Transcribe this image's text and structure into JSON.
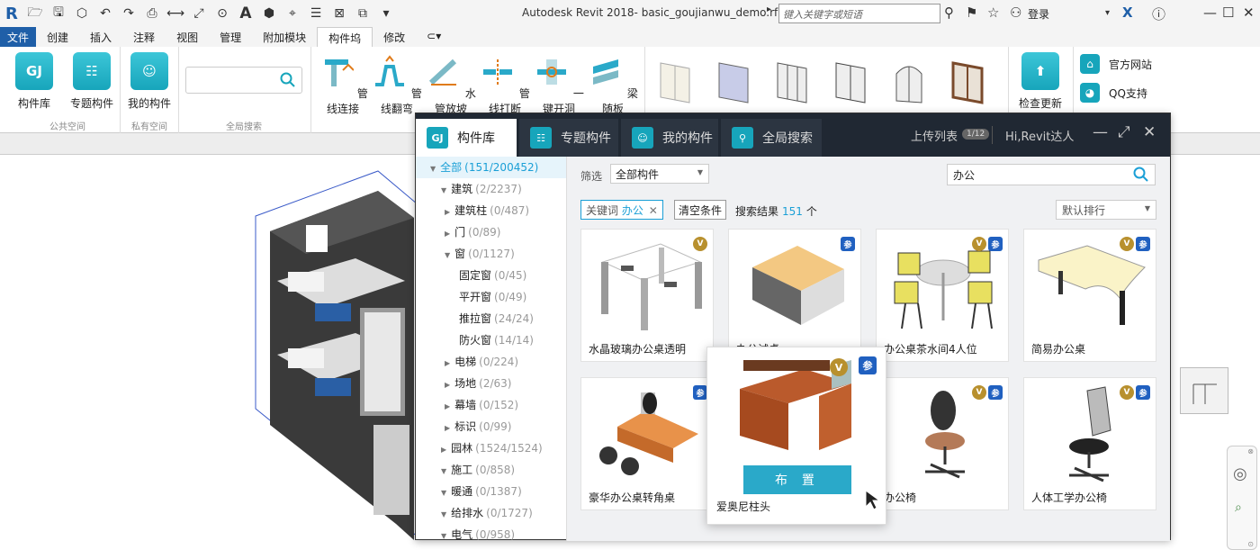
{
  "titlebar": {
    "app_title": "Autodesk Revit 2018-  basic_goujianwu_demo.rfa",
    "search_placeholder": "键入关键字或短语",
    "login": "登录"
  },
  "menu_tabs": [
    "文件",
    "创建",
    "插入",
    "注释",
    "视图",
    "管理",
    "附加模块",
    "构件坞",
    "修改"
  ],
  "ribbon": {
    "buttons": [
      {
        "label": "构件库",
        "icon": "gj-logo-icon"
      },
      {
        "label": "专题构件",
        "icon": "list-icon"
      },
      {
        "label": "我的构件",
        "icon": "user-icon"
      }
    ],
    "groups": [
      "公共空间",
      "私有空间",
      "全局搜索"
    ],
    "tools": [
      "管线连接",
      "管线翻弯",
      "水管放坡",
      "管线打断",
      "一键开洞",
      "梁随板"
    ],
    "update_label": "检查更新",
    "links": [
      "官方网站",
      "QQ支持"
    ]
  },
  "panel": {
    "tabs": [
      "构件库",
      "专题构件",
      "我的构件",
      "全局搜索"
    ],
    "upload_list": "上传列表",
    "upload_count": "1/12",
    "greeting": "Hi,Revit达人"
  },
  "tree": [
    {
      "label": "全部",
      "count": "(151/200452)",
      "level": 0,
      "expanded": true,
      "selected": true
    },
    {
      "label": "建筑",
      "count": "(2/2237)",
      "level": 1,
      "expanded": true
    },
    {
      "label": "建筑柱",
      "count": "(0/487)",
      "level": 2,
      "expanded": false
    },
    {
      "label": "门",
      "count": "(0/89)",
      "level": 2,
      "expanded": false
    },
    {
      "label": "窗",
      "count": "(0/1127)",
      "level": 2,
      "expanded": true
    },
    {
      "label": "固定窗",
      "count": "(0/45)",
      "level": 3
    },
    {
      "label": "平开窗",
      "count": "(0/49)",
      "level": 3
    },
    {
      "label": "推拉窗",
      "count": "(24/24)",
      "level": 3
    },
    {
      "label": "防火窗",
      "count": "(14/14)",
      "level": 3
    },
    {
      "label": "电梯",
      "count": "(0/224)",
      "level": 2,
      "expanded": false
    },
    {
      "label": "场地",
      "count": "(2/63)",
      "level": 2,
      "expanded": false
    },
    {
      "label": "幕墙",
      "count": "(0/152)",
      "level": 2,
      "expanded": false
    },
    {
      "label": "标识",
      "count": "(0/99)",
      "level": 2,
      "expanded": false
    },
    {
      "label": "园林",
      "count": "(1524/1524)",
      "level": 1,
      "expanded": false
    },
    {
      "label": "施工",
      "count": "(0/858)",
      "level": 1,
      "expanded": true
    },
    {
      "label": "暖通",
      "count": "(0/1387)",
      "level": 1,
      "expanded": true
    },
    {
      "label": "给排水",
      "count": "(0/1727)",
      "level": 1,
      "expanded": true
    },
    {
      "label": "电气",
      "count": "(0/958)",
      "level": 1,
      "expanded": true
    }
  ],
  "content": {
    "filter_label": "筛选",
    "filter_value": "全部构件",
    "search_value": "办公",
    "keyword_label": "关键词",
    "keyword_value": "办公",
    "clear_label": "清空条件",
    "result_label": "搜索结果",
    "result_count": "151",
    "result_unit": "个",
    "sort_value": "默认排行"
  },
  "cards": [
    {
      "name": "水晶玻璃办公桌透明",
      "badges": [
        "V"
      ],
      "image": "glass-desk"
    },
    {
      "name": "办公试桌",
      "badges": [
        "参"
      ],
      "image": "block-desk"
    },
    {
      "name": "办公桌茶水间4人位",
      "badges": [
        "V",
        "参"
      ],
      "image": "round-table-chairs"
    },
    {
      "name": "简易办公桌",
      "badges": [
        "V",
        "参"
      ],
      "image": "curved-desk"
    },
    {
      "name": "豪华办公桌转角桌",
      "badges": [
        "参"
      ],
      "image": "corner-desk"
    },
    {
      "name": "办公椅",
      "badges": [
        "V",
        "参"
      ],
      "image": "office-chair"
    },
    {
      "name": "人体工学办公椅",
      "badges": [
        "V",
        "参"
      ],
      "image": "ergonomic-chair"
    }
  ],
  "popup": {
    "name": "爱奥尼柱头",
    "button": "布 置",
    "badges": [
      "V",
      "参"
    ]
  },
  "colors": {
    "accent": "#17a5bb",
    "panel_header": "#202833",
    "link_blue": "#1a9fd6",
    "place_button": "#2aa9c9",
    "revit_blue": "#1f5fa8"
  }
}
